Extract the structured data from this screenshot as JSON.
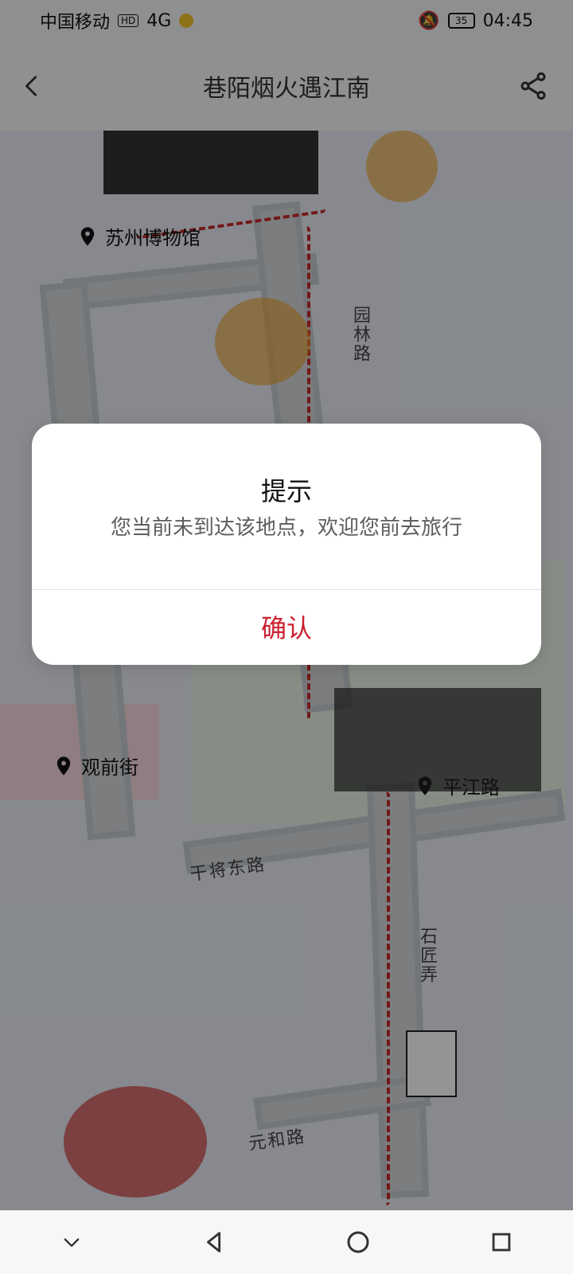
{
  "status": {
    "carrier": "中国移动",
    "hd": "HD",
    "net": "4G",
    "battery": "35",
    "time": "04:45"
  },
  "header": {
    "title": "巷陌烟火遇江南"
  },
  "map": {
    "pois": [
      {
        "name": "苏州博物馆"
      },
      {
        "name": "观前街"
      },
      {
        "name": "平江路"
      }
    ],
    "roads": [
      {
        "name": "园林路"
      },
      {
        "name": "干将东路"
      },
      {
        "name": "石匠弄"
      },
      {
        "name": "元和路"
      }
    ]
  },
  "dialog": {
    "title": "提示",
    "message": "您当前未到达该地点，欢迎您前去旅行",
    "confirm_label": "确认"
  },
  "icons": {
    "back": "chevron-left-icon",
    "share": "share-icon",
    "poi": "map-pin-icon"
  },
  "colors": {
    "accent": "#cc1f2e"
  }
}
